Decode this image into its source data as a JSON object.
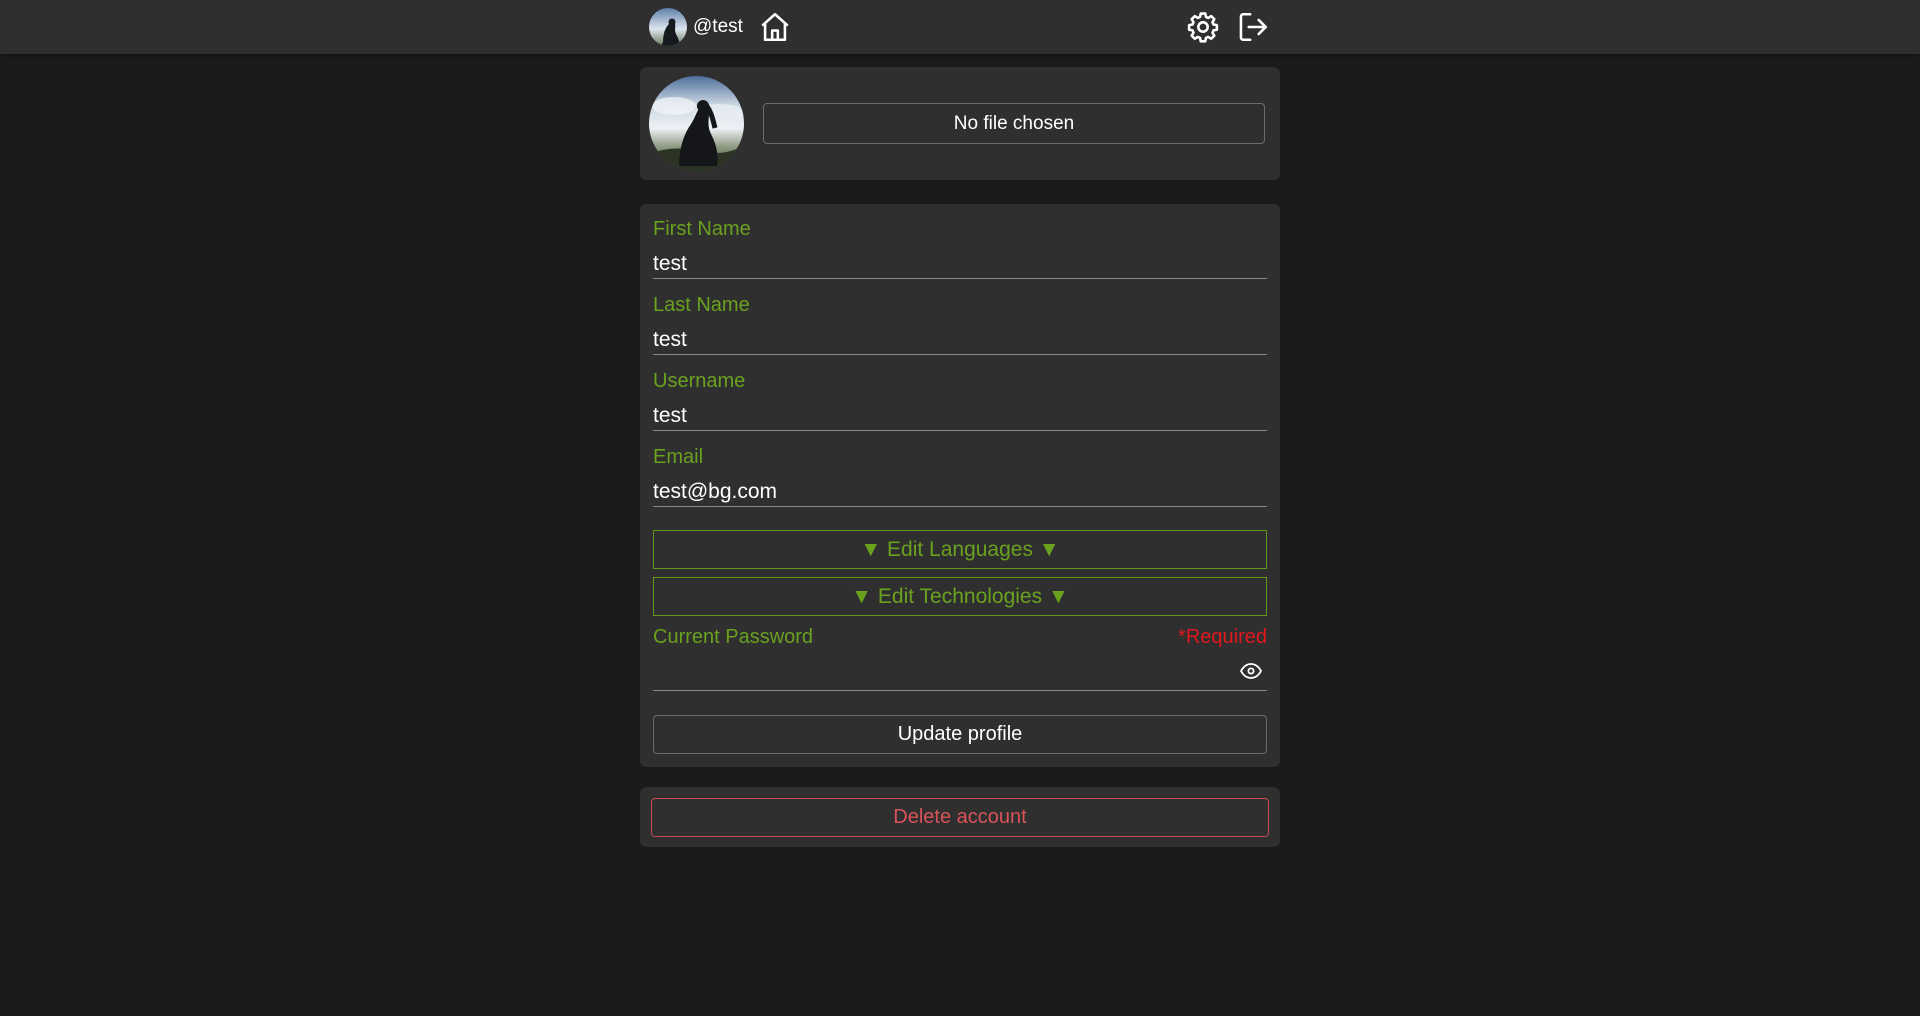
{
  "nav": {
    "username": "@test",
    "icons": [
      "avatar",
      "home-icon",
      "gear-icon",
      "logout-icon"
    ]
  },
  "avatar_card": {
    "file_button_label": "No file chosen"
  },
  "form": {
    "fields": [
      {
        "label": "First Name",
        "value": "test"
      },
      {
        "label": "Last Name",
        "value": "test"
      },
      {
        "label": "Username",
        "value": "test"
      },
      {
        "label": "Email",
        "value": "test@bg.com"
      }
    ],
    "edit_languages_label": "▼ Edit Languages ▼",
    "edit_technologies_label": "▼ Edit Technologies ▼",
    "password": {
      "label": "Current Password",
      "required_label": "*Required",
      "value": ""
    },
    "update_button_label": "Update profile"
  },
  "danger": {
    "delete_button_label": "Delete account"
  },
  "colors": {
    "background": "#1a1b1d",
    "panel": "#2f2f2f",
    "accent_green": "#6aa11f",
    "required_red": "#e0181e",
    "danger": "#d9535a"
  }
}
